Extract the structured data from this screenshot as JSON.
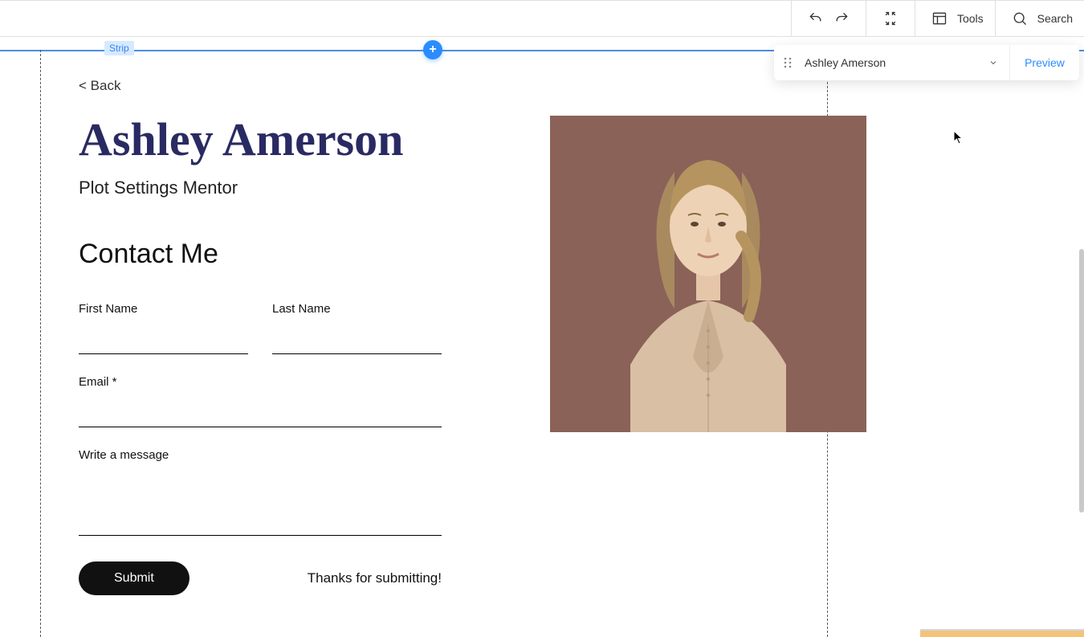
{
  "toolbar": {
    "tools_label": "Tools",
    "search_label": "Search"
  },
  "strip_label": "Strip",
  "page_panel": {
    "page_name": "Ashley Amerson",
    "preview_label": "Preview"
  },
  "content": {
    "back_link": "< Back",
    "title": "Ashley Amerson",
    "subtitle": "Plot Settings Mentor",
    "section_heading": "Contact Me",
    "fields": {
      "first_name_label": "First Name",
      "last_name_label": "Last Name",
      "email_label": "Email *",
      "message_label": "Write a message"
    },
    "submit_label": "Submit",
    "thanks_message": "Thanks for submitting!"
  }
}
